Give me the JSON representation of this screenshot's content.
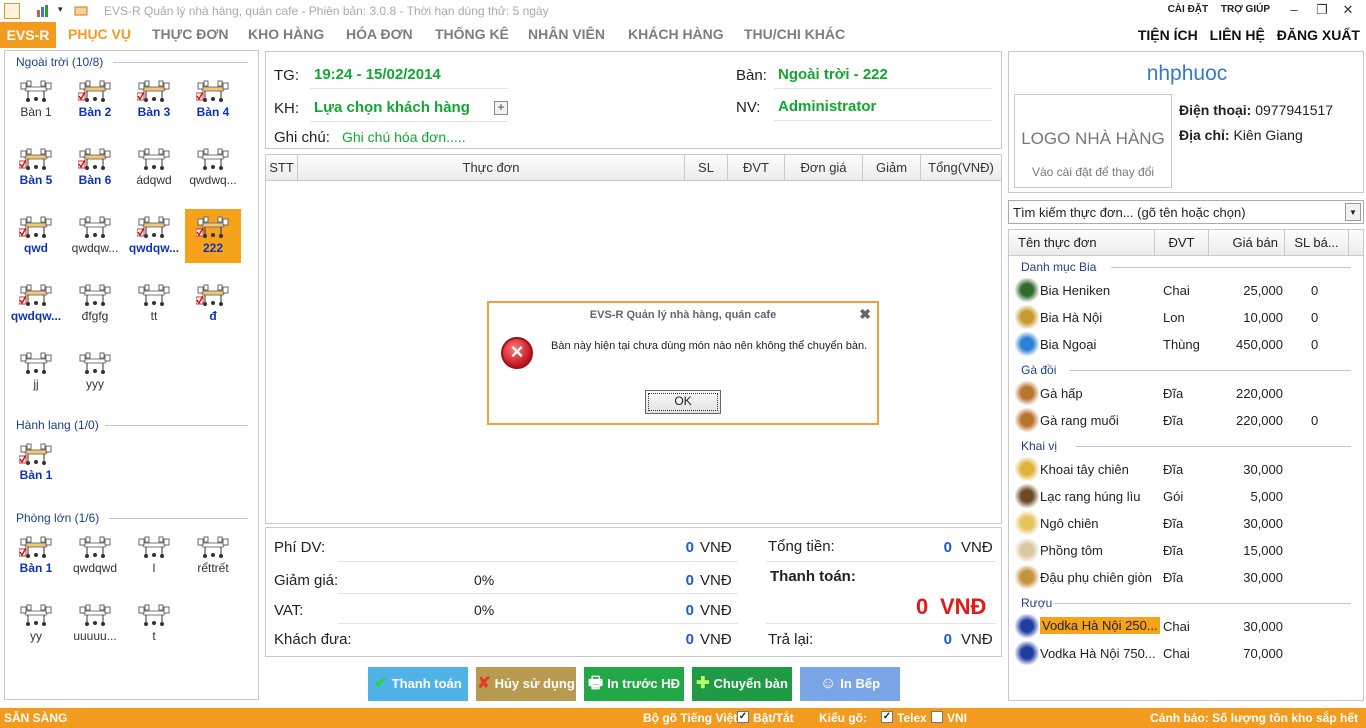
{
  "window": {
    "title": "EVS-R Quản lý nhà hàng, quán cafe - Phiên bản: 3.0.8 - Thời hạn dùng thử: 5 ngày",
    "links": [
      "CÀI ĐẶT",
      "TRỢ GIÚP"
    ],
    "controls": [
      "–",
      "❐",
      "✕"
    ]
  },
  "menubar": {
    "logo": "EVS-R",
    "items": [
      "PHỤC VỤ",
      "THỰC ĐƠN",
      "KHO HÀNG",
      "HÓA ĐƠN",
      "THỐNG KÊ",
      "NHÂN VIÊN",
      "KHÁCH HÀNG",
      "THU/CHI KHÁC"
    ],
    "right_items": [
      "TIỆN ÍCH",
      "LIÊN HỆ",
      "ĐĂNG XUẤT"
    ]
  },
  "tables": {
    "groups": [
      {
        "title": "Ngoài trời (10/8)",
        "items": [
          {
            "label": "Bàn 1",
            "status": "free"
          },
          {
            "label": "Bàn 2",
            "status": "occupied"
          },
          {
            "label": "Bàn 3",
            "status": "occupied"
          },
          {
            "label": "Bàn 4",
            "status": "occupied"
          },
          {
            "label": "Bàn 5",
            "status": "occupied"
          },
          {
            "label": "Bàn 6",
            "status": "occupied"
          },
          {
            "label": "ádqwd",
            "status": "free"
          },
          {
            "label": "qwdwq...",
            "status": "free"
          },
          {
            "label": "qwd",
            "status": "occupied"
          },
          {
            "label": "qwdqw...",
            "status": "free"
          },
          {
            "label": "qwdqw...",
            "status": "occupied"
          },
          {
            "label": "222",
            "status": "selected"
          },
          {
            "label": "qwdqw...",
            "status": "occupied"
          },
          {
            "label": "đfgfg",
            "status": "free"
          },
          {
            "label": "tt",
            "status": "free"
          },
          {
            "label": "đ",
            "status": "occupied"
          },
          {
            "label": "jj",
            "status": "free"
          },
          {
            "label": "yyy",
            "status": "free"
          }
        ]
      },
      {
        "title": "Hành lang (1/0)",
        "items": [
          {
            "label": "Bàn 1",
            "status": "occupied"
          }
        ]
      },
      {
        "title": "Phòng lớn (1/6)",
        "items": [
          {
            "label": "Bàn 1",
            "status": "occupied"
          },
          {
            "label": "qwdqwd",
            "status": "free"
          },
          {
            "label": "l",
            "status": "free"
          },
          {
            "label": "rểttrết",
            "status": "free"
          },
          {
            "label": "yy",
            "status": "free"
          },
          {
            "label": "uuuuu...",
            "status": "free"
          },
          {
            "label": "t",
            "status": "free"
          }
        ]
      }
    ]
  },
  "order_info": {
    "tg_label": "TG:",
    "tg_value": "19:24 - 15/02/2014",
    "ban_label": "Bàn:",
    "ban_value": "Ngoài trời - 222",
    "kh_label": "KH:",
    "kh_value": "Lựa chọn khách hàng",
    "nv_label": "NV:",
    "nv_value": "Administrator",
    "note_label": "Ghi chú:",
    "note_placeholder": "Ghi chú hóa đơn....."
  },
  "order_grid": {
    "columns": [
      "STT",
      "Thực đơn",
      "SL",
      "ĐVT",
      "Đơn giá",
      "Giảm",
      "Tổng(VNĐ)"
    ]
  },
  "totals": {
    "phi_dv_label": "Phí DV:",
    "phi_dv_value": "0",
    "giam_gia_label": "Giảm giá:",
    "giam_gia_pct": "0%",
    "giam_gia_value": "0",
    "vat_label": "VAT:",
    "vat_pct": "0%",
    "vat_value": "0",
    "khach_dua_label": "Khách đưa:",
    "khach_dua_value": "0",
    "tong_tien_label": "Tổng tiền:",
    "tong_tien_value": "0",
    "thanh_toan_label": "Thanh toán:",
    "thanh_toan_value": "0",
    "tra_lai_label": "Trả lại:",
    "tra_lai_value": "0",
    "unit": "VNĐ"
  },
  "actions": {
    "pay": "Thanh toán",
    "cancel": "Hủy sử dụng",
    "print_before": "In trước HĐ",
    "transfer": "Chuyển bàn",
    "kitchen": "In Bếp"
  },
  "shop": {
    "name": "nhphuoc",
    "logo_title": "LOGO NHÀ HÀNG",
    "logo_sub": "Vào cài đặt để thay đổi",
    "phone_label": "Điện thoại:",
    "phone": "0977941517",
    "address_label": "Địa chỉ:",
    "address": "Kiên Giang"
  },
  "menu_search": {
    "placeholder": "Tìm kiếm thực đơn... (gõ tên hoặc chọn)"
  },
  "menu_list": {
    "columns": [
      "Tên thực đơn",
      "ĐVT",
      "Giá bán",
      "SL bá..."
    ],
    "categories": [
      {
        "name": "Danh mục Bia",
        "items": [
          {
            "name": "Bia Heniken",
            "unit": "Chai",
            "price": "25,000",
            "qty": "0",
            "thumb": "beer-bottle-icon"
          },
          {
            "name": "Bia Hà Nội",
            "unit": "Lon",
            "price": "10,000",
            "qty": "0",
            "thumb": "beer-can-icon"
          },
          {
            "name": "Bia Ngoại",
            "unit": "Thùng",
            "price": "450,000",
            "qty": "0",
            "thumb": "cutlery-icon"
          }
        ]
      },
      {
        "name": "Gà đồi",
        "items": [
          {
            "name": "Gà hấp",
            "unit": "Đĩa",
            "price": "220,000",
            "qty": "",
            "thumb": "chicken-dish-icon"
          },
          {
            "name": "Gà rang muối",
            "unit": "Đĩa",
            "price": "220,000",
            "qty": "0",
            "thumb": "chicken-dish-icon"
          }
        ]
      },
      {
        "name": "Khai vị",
        "items": [
          {
            "name": "Khoai tây chiên",
            "unit": "Đĩa",
            "price": "30,000",
            "qty": "",
            "thumb": "fries-icon"
          },
          {
            "name": "Lạc rang húng lìu",
            "unit": "Gói",
            "price": "5,000",
            "qty": "",
            "thumb": "peanut-icon"
          },
          {
            "name": "Ngô chiên",
            "unit": "Đĩa",
            "price": "30,000",
            "qty": "",
            "thumb": "corn-icon"
          },
          {
            "name": "Phồng tôm",
            "unit": "Đĩa",
            "price": "15,000",
            "qty": "",
            "thumb": "cracker-icon"
          },
          {
            "name": "Đậu phụ chiên giòn",
            "unit": "Đĩa",
            "price": "30,000",
            "qty": "",
            "thumb": "tofu-icon"
          }
        ]
      },
      {
        "name": "Rượu",
        "items": [
          {
            "name": "Vodka Hà Nội 250...",
            "unit": "Chai",
            "price": "30,000",
            "qty": "",
            "thumb": "vodka-bottle-icon",
            "highlight": true
          },
          {
            "name": "Vodka Hà Nội 750...",
            "unit": "Chai",
            "price": "70,000",
            "qty": "",
            "thumb": "vodka-bottle-icon"
          }
        ]
      }
    ]
  },
  "statusbar": {
    "ready": "SẴN SÀNG",
    "ime_label": "Bộ gõ Tiếng Việt",
    "ime_toggle": "Bật/Tắt",
    "typing_label": "Kiểu gõ:",
    "telex": "Telex",
    "vni": "VNI",
    "warning": "Cảnh báo: Số lượng tồn kho sắp hết"
  },
  "dialog": {
    "title": "EVS-R Quản lý nhà hàng, quán cafe",
    "message": "Bàn này hiện tại chưa dùng món nào nên không thể chuyển bàn.",
    "ok": "OK"
  },
  "colors": {
    "accent": "#f39b1e",
    "green": "#12a632",
    "blue_link": "#1033b8",
    "red_total": "#e01b1b",
    "btn_pay": "#4fb3e8",
    "btn_cancel": "#b89a50",
    "btn_print": "#22a847",
    "btn_transfer": "#1f9a45",
    "btn_kitchen": "#7aa6e8"
  }
}
